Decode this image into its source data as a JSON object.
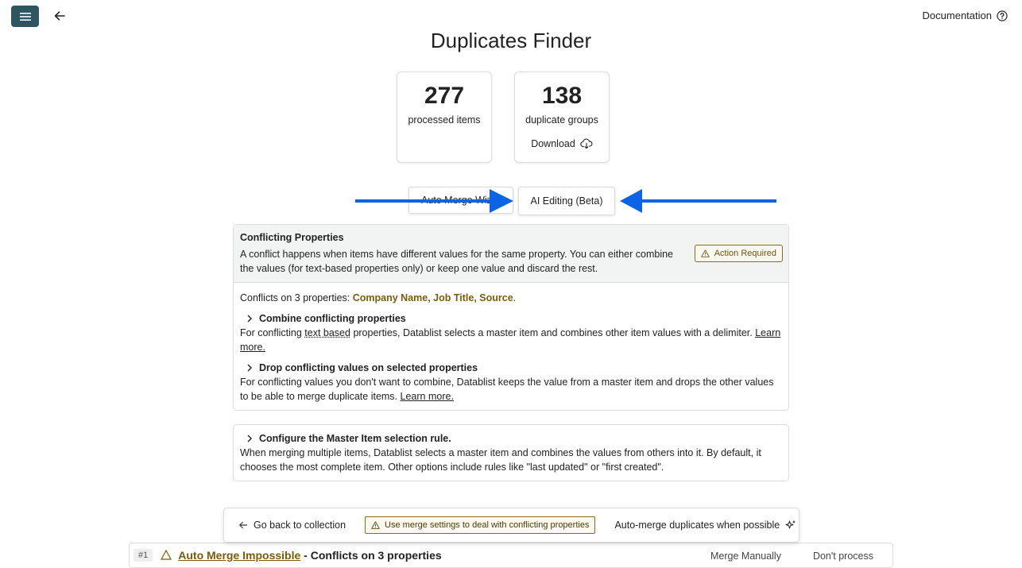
{
  "header": {
    "documentation_label": "Documentation"
  },
  "page_title": "Duplicates Finder",
  "stats": {
    "processed": {
      "value": "277",
      "label": "processed items"
    },
    "groups": {
      "value": "138",
      "label": "duplicate groups",
      "download_label": "Download"
    }
  },
  "tabs": [
    {
      "label": "Auto Merge Wiz"
    },
    {
      "label": "AI Editing (Beta)"
    }
  ],
  "conflicts_panel": {
    "title": "Conflicting Properties",
    "description": "A conflict happens when items have different values for the same property. You can either combine the values (for text-based properties only) or keep one value and discard the rest.",
    "badge": "Action Required",
    "summary_prefix": "Conflicts on 3 properties: ",
    "summary_props": "Company Name, Job Title, Source",
    "summary_suffix": ".",
    "combine": {
      "heading": "Combine conflicting properties",
      "text_a": "For conflicting ",
      "text_term": "text based",
      "text_b": " properties, Datablist selects a master item and combines other item values with a delimiter. ",
      "link": "Learn more."
    },
    "drop": {
      "heading": "Drop conflicting values on selected properties",
      "text": "For conflicting values you don't want to combine, Datablist keeps the value from a master item and drops the other values to be able to merge duplicate items. ",
      "link": "Learn more."
    }
  },
  "master_panel": {
    "heading": "Configure the Master Item selection rule.",
    "text": "When merging multiple items, Datablist selects a master item and combines the values from others into it. By default, it chooses the most complete item. Other options include rules like \"last updated\" or \"first created\"."
  },
  "footer": {
    "back_label": "Go back to collection",
    "warning_label": "Use merge settings to deal with conflicting properties",
    "auto_merge_label": "Auto-merge duplicates when possible"
  },
  "group_row": {
    "index": "#1",
    "status": "Auto Merge Impossible",
    "separator": " - ",
    "detail": "Conflicts on 3 properties",
    "merge_label": "Merge Manually",
    "dont_process_label": "Don't process"
  },
  "colors": {
    "accent_dark": "#2f5563",
    "highlight": "#7a5c0c",
    "arrow": "#0b63e6"
  }
}
